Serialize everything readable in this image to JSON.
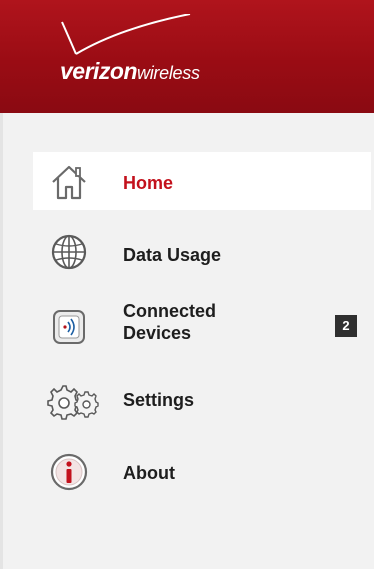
{
  "header": {
    "brand_bold": "verizon",
    "brand_light": "wireless",
    "color": "#9e0e16"
  },
  "colors": {
    "active_label": "#c3111c",
    "label": "#1e1e1e",
    "panel_bg": "#f2f2f2",
    "badge_bg": "#2f2f2f"
  },
  "nav": {
    "items": [
      {
        "label": "Home",
        "icon": "home-icon",
        "active": true
      },
      {
        "label": "Data Usage",
        "icon": "globe-icon"
      },
      {
        "label": "Connected Devices",
        "icon": "device-icon",
        "badge": "2"
      },
      {
        "label": "Settings",
        "icon": "gears-icon"
      },
      {
        "label": "About",
        "icon": "info-icon"
      }
    ]
  }
}
